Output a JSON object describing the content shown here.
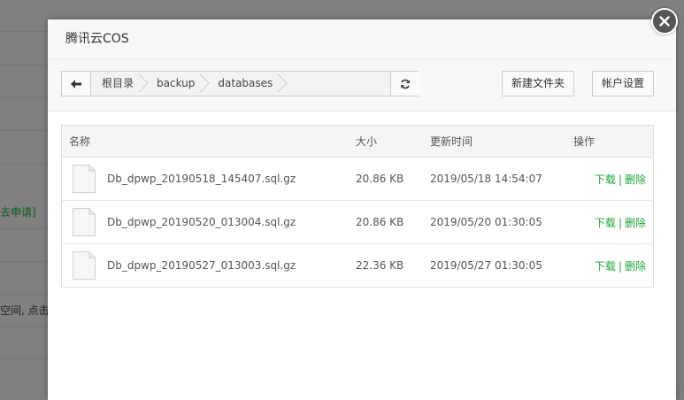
{
  "background": {
    "snippet_1": "去申请]",
    "snippet_2": "空间, 点击"
  },
  "dialog": {
    "title": "腾讯云COS",
    "close_icon": "close-icon"
  },
  "toolbar": {
    "back_icon": "arrow-left-icon",
    "breadcrumb": [
      "根目录",
      "backup",
      "databases"
    ],
    "refresh_icon": "refresh-icon",
    "new_folder_label": "新建文件夹",
    "account_settings_label": "帐户设置"
  },
  "table": {
    "headers": {
      "name": "名称",
      "size": "大小",
      "modified": "更新时间",
      "actions": "操作"
    },
    "rows": [
      {
        "name": "Db_dpwp_20190518_145407.sql.gz",
        "size": "20.86 KB",
        "modified": "2019/05/18 14:54:07",
        "download": "下载",
        "sep": "|",
        "delete": "删除"
      },
      {
        "name": "Db_dpwp_20190520_013004.sql.gz",
        "size": "20.86 KB",
        "modified": "2019/05/20 01:30:05",
        "download": "下载",
        "sep": "|",
        "delete": "删除"
      },
      {
        "name": "Db_dpwp_20190527_013003.sql.gz",
        "size": "22.36 KB",
        "modified": "2019/05/27 01:30:05",
        "download": "下载",
        "sep": "|",
        "delete": "删除"
      }
    ]
  },
  "colors": {
    "accent_green": "#20a53a",
    "overlay": "#808080"
  }
}
